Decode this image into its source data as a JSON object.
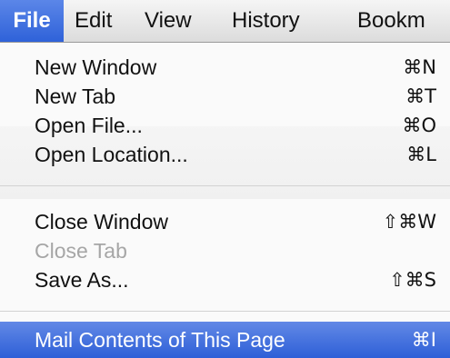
{
  "menubar": {
    "items": [
      {
        "label": "File"
      },
      {
        "label": "Edit"
      },
      {
        "label": "View"
      },
      {
        "label": "History"
      },
      {
        "label": "Bookm"
      }
    ]
  },
  "file_menu": {
    "group1": [
      {
        "label": "New Window",
        "shortcut": "⌘N"
      },
      {
        "label": "New Tab",
        "shortcut": "⌘T"
      },
      {
        "label": "Open File...",
        "shortcut": "⌘O"
      },
      {
        "label": "Open Location...",
        "shortcut": "⌘L"
      }
    ],
    "group2": [
      {
        "label": "Close Window",
        "shortcut": "⇧⌘W"
      },
      {
        "label": "Close Tab",
        "shortcut": "",
        "disabled": true
      },
      {
        "label": "Save As...",
        "shortcut": "⇧⌘S"
      }
    ],
    "highlighted": {
      "label": "Mail Contents of This Page",
      "shortcut": "⌘I"
    }
  },
  "colors": {
    "highlight": "#2e5fd7",
    "disabled_text": "#a6a6a6"
  }
}
